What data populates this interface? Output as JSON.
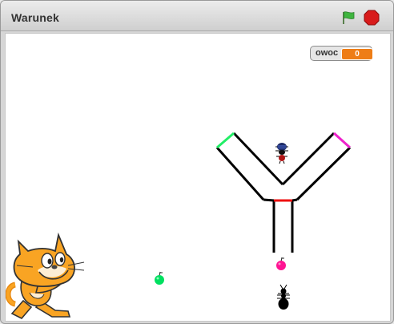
{
  "window": {
    "title": "Warunek"
  },
  "toolbar": {
    "green_flag_icon": "green-flag-icon",
    "stop_icon": "stop-sign-icon"
  },
  "stage": {
    "variable_monitor": {
      "name": "owoc",
      "value": "0"
    },
    "sprites": [
      "scratch-cat",
      "y-maze",
      "ant-top",
      "ant-bottom",
      "pink-fruit",
      "green-fruit"
    ]
  },
  "colors": {
    "monitor_value": "#ee7d16",
    "maze_left_end": "#22ee66",
    "maze_right_end": "#ee22cc",
    "maze_bottom_gate": "#ee1111",
    "fruit_pink": "#ff1493",
    "fruit_green": "#00e060"
  }
}
